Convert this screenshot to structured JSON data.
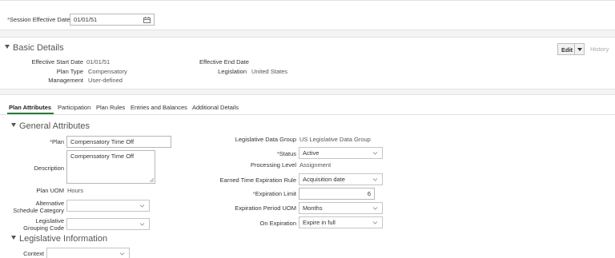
{
  "session": {
    "label": "Session Effective Date",
    "required_mark": "*",
    "value": "01/01/51"
  },
  "basic_details": {
    "title": "Basic Details",
    "edit_label": "Edit",
    "history_label": "History",
    "fields": {
      "effective_start_label": "Effective Start Date",
      "effective_start_value": "01/01/51",
      "effective_end_label": "Effective End Date",
      "plan_type_label": "Plan Type",
      "plan_type_value": "Compensatory",
      "legislation_label": "Legislation",
      "legislation_value": "United States",
      "management_label": "Management",
      "management_value": "User-defined"
    }
  },
  "tabs": [
    {
      "label": "Plan Attributes",
      "active": true
    },
    {
      "label": "Participation"
    },
    {
      "label": "Plan Rules"
    },
    {
      "label": "Entries and Balances"
    },
    {
      "label": "Additional Details"
    }
  ],
  "general_attributes": {
    "title": "General Attributes",
    "plan_label": "Plan",
    "plan_value": "Compensatory Time Off",
    "description_label": "Description",
    "description_value": "Compensatory Time Off",
    "plan_uom_label": "Plan UOM",
    "plan_uom_value": "Hours",
    "alt_schedule_label_1": "Alternative",
    "alt_schedule_label_2": "Schedule Category",
    "alt_schedule_value": "",
    "leg_grouping_label_1": "Legislative",
    "leg_grouping_label_2": "Grouping Code",
    "leg_grouping_value": "",
    "leg_data_group_label": "Legislative Data Group",
    "leg_data_group_value": "US Legislative Data Group",
    "status_label": "Status",
    "status_value": "Active",
    "processing_level_label": "Processing Level",
    "processing_level_value": "Assignment",
    "earned_rule_label": "Earned Time Expiration Rule",
    "earned_rule_value": "Acquisition date",
    "expiration_limit_label": "Expiration Limit",
    "expiration_limit_value": "6",
    "expiration_uom_label": "Expiration Period UOM",
    "expiration_uom_value": "Months",
    "on_expiration_label": "On Expiration",
    "on_expiration_value": "Expire in full"
  },
  "legislative_information": {
    "title": "Legislative Information",
    "context_label": "Context",
    "context_value": ""
  },
  "colors": {
    "required": "#1a64b0",
    "active_tab_underline": "#2c7a3f"
  }
}
